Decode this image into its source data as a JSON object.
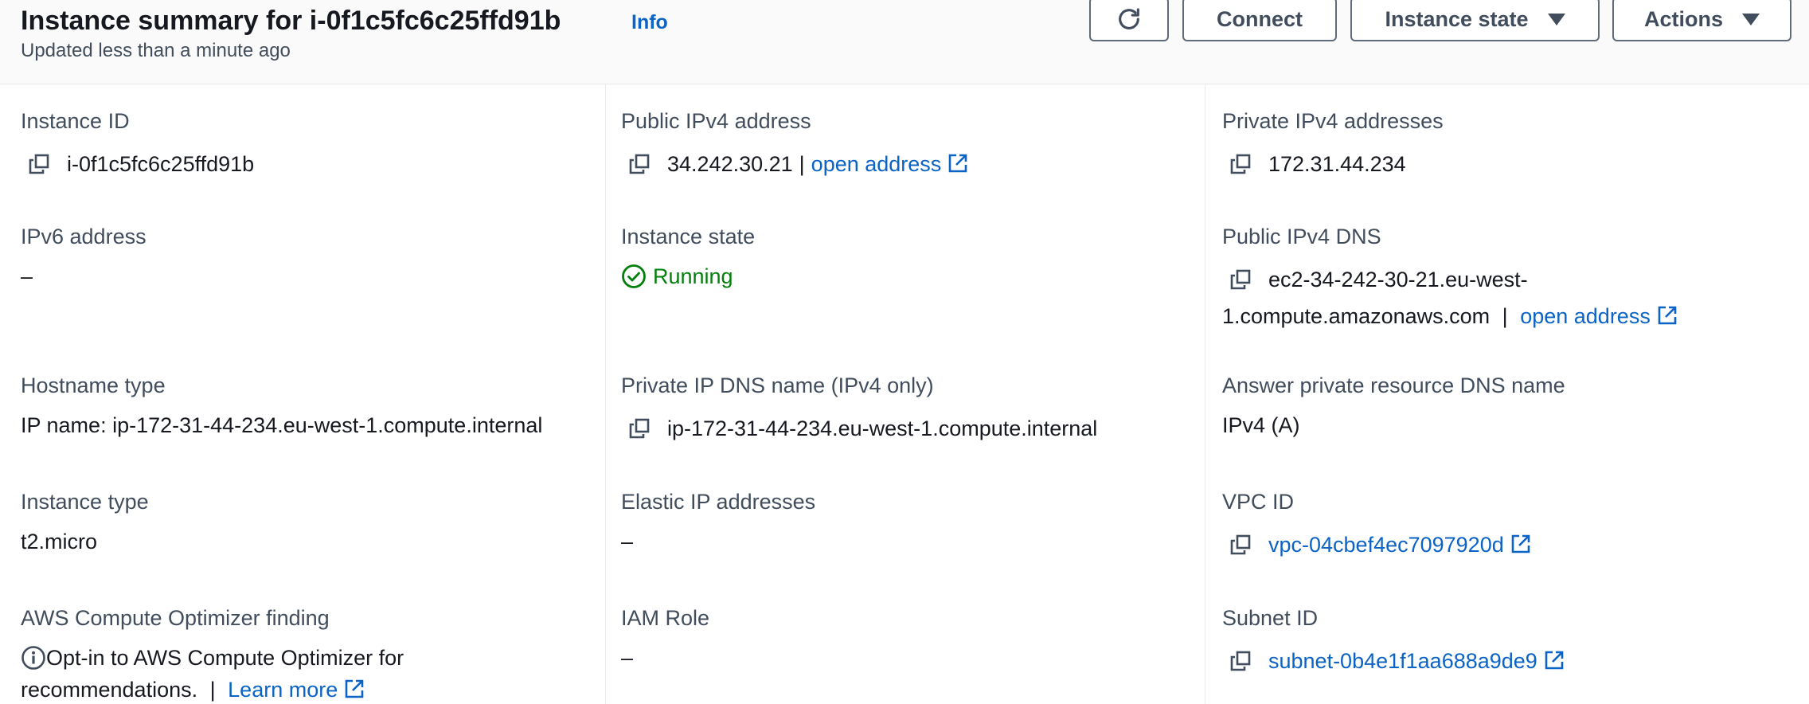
{
  "header": {
    "title": "Instance summary for i-0f1c5fc6c25ffd91b",
    "info_link": "Info",
    "subtitle": "Updated less than a minute ago",
    "buttons": {
      "refresh_icon": "refresh-icon",
      "connect": "Connect",
      "instance_state": "Instance state",
      "actions": "Actions"
    }
  },
  "fields": {
    "instance_id": {
      "label": "Instance ID",
      "value": "i-0f1c5fc6c25ffd91b"
    },
    "public_ipv4": {
      "label": "Public IPv4 address",
      "value": "34.242.30.21",
      "separator": "|",
      "link": "open address"
    },
    "private_ipv4": {
      "label": "Private IPv4 addresses",
      "value": "172.31.44.234"
    },
    "ipv6": {
      "label": "IPv6 address",
      "value": "–"
    },
    "instance_state": {
      "label": "Instance state",
      "value": "Running",
      "status_color": "#037f0c"
    },
    "public_dns": {
      "label": "Public IPv4 DNS",
      "value_line1": "ec2-34-242-30-21.eu-west-",
      "value_line2": "1.compute.amazonaws.com",
      "separator": "|",
      "link": "open address"
    },
    "hostname_type": {
      "label": "Hostname type",
      "value": "IP name: ip-172-31-44-234.eu-west-1.compute.internal"
    },
    "private_dns": {
      "label": "Private IP DNS name (IPv4 only)",
      "value": "ip-172-31-44-234.eu-west-1.compute.internal"
    },
    "answer_dns": {
      "label": "Answer private resource DNS name",
      "value": "IPv4 (A)"
    },
    "instance_type": {
      "label": "Instance type",
      "value": "t2.micro"
    },
    "elastic_ip": {
      "label": "Elastic IP addresses",
      "value": "–"
    },
    "vpc_id": {
      "label": "VPC ID",
      "value": "vpc-04cbef4ec7097920d"
    },
    "optimizer": {
      "label": "AWS Compute Optimizer finding",
      "value_line1": "Opt-in to AWS Compute Optimizer for",
      "value_line2": "recommendations.",
      "separator": "|",
      "link": "Learn more"
    },
    "iam_role": {
      "label": "IAM Role",
      "value": "–"
    },
    "subnet_id": {
      "label": "Subnet ID",
      "value": "subnet-0b4e1f1aa688a9de9"
    }
  },
  "colors": {
    "link": "#0b63c5",
    "success": "#037f0c",
    "text": "#16191f",
    "label": "#414d5c"
  }
}
